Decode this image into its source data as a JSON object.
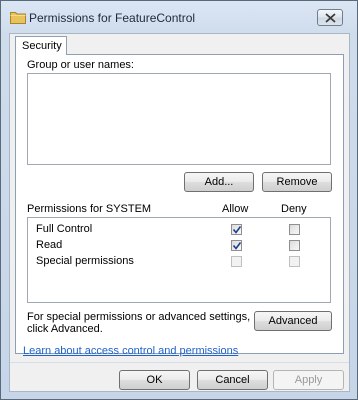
{
  "window": {
    "title": "Permissions for FeatureControl"
  },
  "tabs": [
    {
      "label": "Security"
    }
  ],
  "group_section": {
    "label": "Group or user names:",
    "entries": []
  },
  "group_buttons": {
    "add_label": "Add...",
    "remove_label": "Remove"
  },
  "permissions": {
    "header_label": "Permissions for SYSTEM",
    "allow_label": "Allow",
    "deny_label": "Deny",
    "rows": [
      {
        "name": "Full Control",
        "allow": true,
        "deny": false,
        "enabled": true
      },
      {
        "name": "Read",
        "allow": true,
        "deny": false,
        "enabled": true
      },
      {
        "name": "Special permissions",
        "allow": false,
        "deny": false,
        "enabled": false
      }
    ]
  },
  "advanced": {
    "text_line1": "For special permissions or advanced settings,",
    "text_line2": "click Advanced.",
    "button_label": "Advanced"
  },
  "learn_link": "Learn about access control and permissions",
  "footer": {
    "ok_label": "OK",
    "cancel_label": "Cancel",
    "apply_label": "Apply"
  },
  "colors": {
    "link": "#1f62c9",
    "titlebar": "#dbe6f4",
    "folder_icon": "#e8c25a"
  }
}
